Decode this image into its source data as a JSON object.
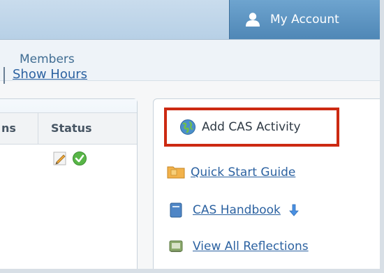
{
  "header": {
    "my_account_label": "My Account"
  },
  "nav": {
    "members_label": "Members"
  },
  "left_panel": {
    "show_hours_label": "Show Hours",
    "table": {
      "columns": [
        "ns",
        "Status"
      ]
    }
  },
  "right_panel": {
    "add_activity_label": "Add CAS Activity",
    "links": [
      {
        "label": "Quick Start Guide",
        "icon": "folder-icon"
      },
      {
        "label": "CAS Handbook",
        "icon": "book-icon"
      },
      {
        "label": "View All Reflections",
        "icon": "reflection-icon"
      }
    ]
  },
  "colors": {
    "accent": "#5b93c2",
    "link": "#2c62a1",
    "highlight_border": "#cc2a12"
  }
}
